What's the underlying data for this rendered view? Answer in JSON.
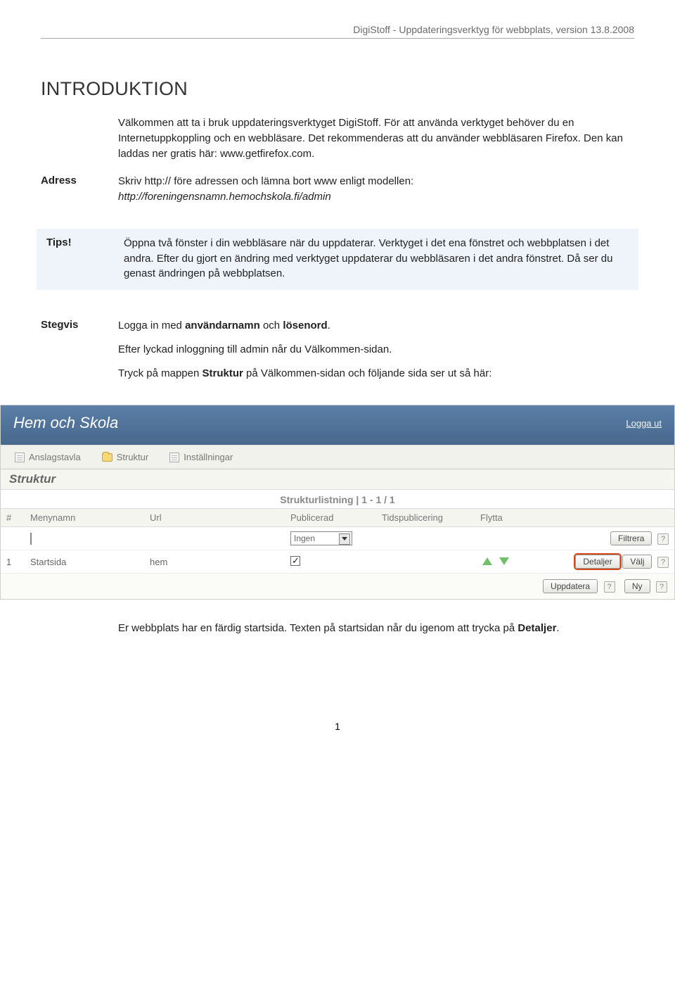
{
  "header": {
    "text": "DigiStoff - Uppdateringsverktyg för webbplats, version 13.8.2008"
  },
  "title": "INTRODUKTION",
  "intro_p1": "Välkommen att ta i bruk uppdateringsverktyget DigiStoff. För att använda verktyget behöver du en Internetuppkoppling och en webbläsare. Det rekommenderas att du använder webbläsaren Firefox. Den kan laddas ner gratis här: www.getfirefox.com.",
  "adress": {
    "label": "Adress",
    "text_a": "Skriv http:// före adressen och lämna bort www enligt modellen:",
    "text_b": "http://foreningensnamn.hemochskola.fi/admin"
  },
  "tips": {
    "label": "Tips!",
    "text": "Öppna två fönster i din webbläsare när du uppdaterar. Verktyget i det ena fönstret och webbplatsen i det andra. Efter du gjort en ändring med verktyget uppdaterar du webbläsaren i det andra fönstret. Då ser du genast ändringen på webbplatsen."
  },
  "stegvis": {
    "label": "Stegvis",
    "l1_a": "Logga in med ",
    "l1_b": "användarnamn",
    "l1_c": " och ",
    "l1_d": "lösenord",
    "l1_e": ".",
    "l2": "Efter lyckad inloggning till admin når du Välkommen-sidan.",
    "l3_a": "Tryck på mappen ",
    "l3_b": "Struktur",
    "l3_c": " på Välkommen-sidan och följande sida ser ut så här:"
  },
  "app": {
    "title": "Hem och Skola",
    "logout": "Logga ut",
    "tab1": "Anslagstavla",
    "tab2": "Struktur",
    "tab3": "Inställningar",
    "panel": "Struktur",
    "caption": "Strukturlistning  |  1 - 1 / 1",
    "cols": {
      "num": "#",
      "name": "Menynamn",
      "url": "Url",
      "pub": "Publicerad",
      "time": "Tidspublicering",
      "move": "Flytta",
      "act": ""
    },
    "filter_sel": "Ingen",
    "btn_filter": "Filtrera",
    "row": {
      "num": "1",
      "name": "Startsida",
      "url": "hem"
    },
    "btn_details": "Detaljer",
    "btn_select": "Välj",
    "btn_update": "Uppdatera",
    "btn_new": "Ny"
  },
  "after_a": "Er webbplats har en färdig startsida. Texten på startsidan når du igenom att trycka på ",
  "after_b": "Detaljer",
  "after_c": ".",
  "page_num": "1"
}
